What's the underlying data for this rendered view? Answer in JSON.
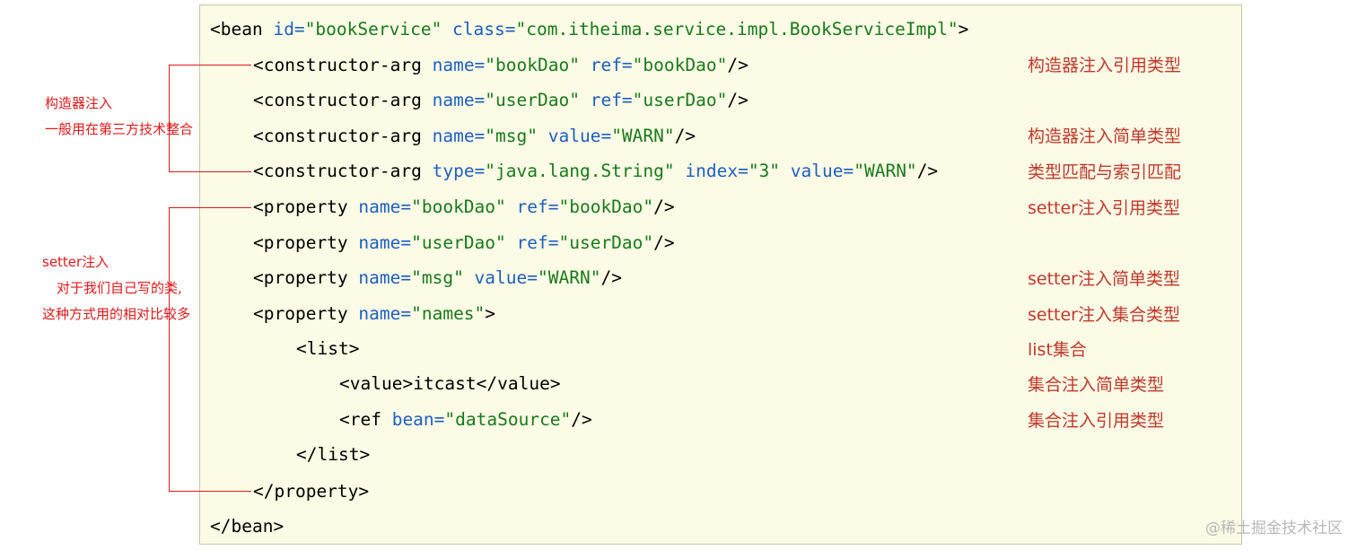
{
  "code": {
    "l1": {
      "open": "<bean ",
      "a1": "id=",
      "v1": "\"bookService\"",
      "a2": " class=",
      "v2": "\"com.itheima.service.impl.BookServiceImpl\"",
      "close": ">"
    },
    "l2": {
      "open": "<constructor-arg ",
      "a1": "name=",
      "v1": "\"bookDao\"",
      "a2": " ref=",
      "v2": "\"bookDao\"",
      "close": "/>"
    },
    "l3": {
      "open": "<constructor-arg ",
      "a1": "name=",
      "v1": "\"userDao\"",
      "a2": " ref=",
      "v2": "\"userDao\"",
      "close": "/>"
    },
    "l4": {
      "open": "<constructor-arg ",
      "a1": "name=",
      "v1": "\"msg\"",
      "a2": " value=",
      "v2": "\"WARN\"",
      "close": "/>"
    },
    "l5": {
      "open": "<constructor-arg ",
      "a1": "type=",
      "v1": "\"java.lang.String\"",
      "a2": " index=",
      "v2": "\"3\"",
      "a3": " value=",
      "v3": "\"WARN\"",
      "close": "/>"
    },
    "l6": {
      "open": "<property ",
      "a1": "name=",
      "v1": "\"bookDao\"",
      "a2": " ref=",
      "v2": "\"bookDao\"",
      "close": "/>"
    },
    "l7": {
      "open": "<property ",
      "a1": "name=",
      "v1": "\"userDao\"",
      "a2": " ref=",
      "v2": "\"userDao\"",
      "close": "/>"
    },
    "l8": {
      "open": "<property ",
      "a1": "name=",
      "v1": "\"msg\"",
      "a2": " value=",
      "v2": "\"WARN\"",
      "close": "/>"
    },
    "l9": {
      "open": "<property ",
      "a1": "name=",
      "v1": "\"names\"",
      "close": ">"
    },
    "l10": {
      "open": "<list",
      "close": ">"
    },
    "l11": {
      "open": "<value",
      "mid": ">",
      "text": "itcast",
      "end": "</value",
      "close": ">"
    },
    "l12": {
      "open": "<ref ",
      "a1": "bean=",
      "v1": "\"dataSource\"",
      "close": "/>"
    },
    "l13": {
      "open": "</list",
      "close": ">"
    },
    "l14": {
      "open": "</property",
      "close": ">"
    },
    "l15": {
      "open": "</bean",
      "close": ">"
    }
  },
  "annotations_right": {
    "a1": "构造器注入引用类型",
    "a2": "构造器注入简单类型",
    "a3": "类型匹配与索引匹配",
    "a4": "setter注入引用类型",
    "a5": "setter注入简单类型",
    "a6": "setter注入集合类型",
    "a7": "list集合",
    "a8": "集合注入简单类型",
    "a9": "集合注入引用类型"
  },
  "annotations_left": {
    "constructor_title": "构造器注入",
    "constructor_note": "一般用在第三方技术整合",
    "setter_title": "setter注入",
    "setter_note1": "对于我们自己写的类,",
    "setter_note2": "这种方式用的相对比较多"
  },
  "watermark": "@稀土掘金技术社区",
  "colors": {
    "panel_bg": "#fbfbe6",
    "tag": "#000000",
    "attr": "#1f5fbf",
    "string": "#1a7a1a",
    "annotation": "#c0392b",
    "bracket": "#e01a1a"
  }
}
